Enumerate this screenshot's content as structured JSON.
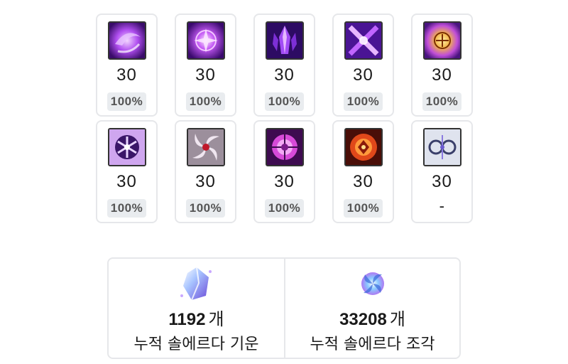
{
  "skills": [
    {
      "icon": "purple-orb-skill-icon",
      "level": "30",
      "progress": "100%"
    },
    {
      "icon": "purple-rune-skill-icon",
      "level": "30",
      "progress": "100%"
    },
    {
      "icon": "purple-crystal-skill-icon",
      "level": "30",
      "progress": "100%"
    },
    {
      "icon": "crossed-blades-skill-icon",
      "level": "30",
      "progress": "100%"
    },
    {
      "icon": "yellow-emblem-skill-icon",
      "level": "30",
      "progress": "100%"
    },
    {
      "icon": "snowflake-sigil-skill-icon",
      "level": "30",
      "progress": "100%"
    },
    {
      "icon": "spiral-vortex-skill-icon",
      "level": "30",
      "progress": "100%"
    },
    {
      "icon": "magenta-seal-skill-icon",
      "level": "30",
      "progress": "100%"
    },
    {
      "icon": "fire-seal-skill-icon",
      "level": "30",
      "progress": "100%"
    },
    {
      "icon": "twin-rings-skill-icon",
      "level": "30",
      "progress": "-"
    }
  ],
  "summary": {
    "energy": {
      "icon": "sol-erda-energy-icon",
      "count": "1192",
      "unit": "개",
      "label": "누적 솔에르다 기운"
    },
    "fragment": {
      "icon": "sol-erda-fragment-icon",
      "count": "33208",
      "unit": "개",
      "label": "누적 솔에르다 조각"
    }
  },
  "colors": {
    "border": "#e6e7ea",
    "badge_bg": "#e9ecef",
    "badge_text": "#555555",
    "accent_purple": "#9b3cf0"
  }
}
